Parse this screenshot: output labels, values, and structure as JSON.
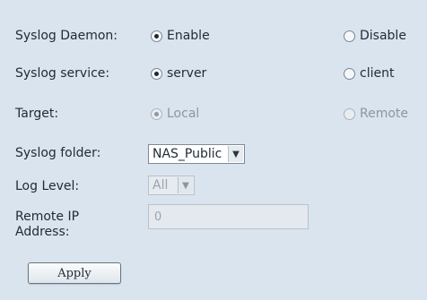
{
  "syslog_daemon": {
    "label": "Syslog Daemon:",
    "option1": "Enable",
    "option2": "Disable",
    "selected": "Enable"
  },
  "syslog_service": {
    "label": "Syslog service:",
    "option1": "server",
    "option2": "client",
    "selected": "server"
  },
  "target": {
    "label": "Target:",
    "option1": "Local",
    "option2": "Remote",
    "selected": "Local"
  },
  "syslog_folder": {
    "label": "Syslog folder:",
    "value": "NAS_Public"
  },
  "log_level": {
    "label": "Log Level:",
    "value": "All"
  },
  "remote_ip": {
    "label_line1": "Remote IP",
    "label_line2": "Address:",
    "value": "0"
  },
  "apply_button": {
    "label": "Apply"
  }
}
